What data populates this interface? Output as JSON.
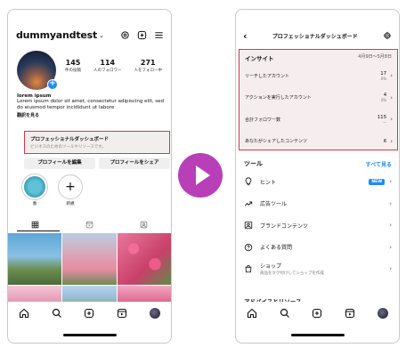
{
  "left": {
    "username": "dummyandtest",
    "stats": [
      {
        "num": "145",
        "label": "件の投稿"
      },
      {
        "num": "114",
        "label": "人のフォロワー"
      },
      {
        "num": "271",
        "label": "人をフォロー中"
      }
    ],
    "bio": {
      "name": "lorem ipsum",
      "text": "Lorem ipsum dolor sit amet, consectetur adipiscing elit, sed do eiusmod tempor incididunt ut labore",
      "translate": "翻訳を見る"
    },
    "dashboard": {
      "title": "プロフェッショナルダッシュボード",
      "subtitle": "ビジネスのためのツールやリソースです。"
    },
    "buttons": {
      "edit": "プロフィールを編集",
      "share": "プロフィールをシェア"
    },
    "highlights": [
      {
        "label": "春"
      },
      {
        "label": "新規"
      }
    ]
  },
  "right": {
    "title": "プロフェッショナルダッシュボード",
    "insights": {
      "title": "インサイト",
      "dates": "4月9日〜5月8日",
      "rows": [
        {
          "label": "リーチしたアカウント",
          "value": "17",
          "pct": "0%"
        },
        {
          "label": "アクションを実行したアカウント",
          "value": "4",
          "pct": "0%"
        },
        {
          "label": "合計フォロワー数",
          "value": "115",
          "pct": "—"
        },
        {
          "label": "あなたがシェアしたコンテンツ",
          "value": "6",
          "pct": ""
        }
      ]
    },
    "tools": {
      "title": "ツール",
      "see_all": "すべて見る",
      "items": [
        {
          "label": "ヒント",
          "sub": "",
          "badge": "NEW",
          "icon": "lightbulb-icon"
        },
        {
          "label": "広告ツール",
          "sub": "",
          "badge": "",
          "icon": "trend-arrow-icon"
        },
        {
          "label": "ブランドコンテンツ",
          "sub": "",
          "badge": "",
          "icon": "branded-content-icon"
        },
        {
          "label": "よくある質問",
          "sub": "",
          "badge": "",
          "icon": "question-icon"
        },
        {
          "label": "ショップ",
          "sub": "商品をタグ付けしてショップを作成",
          "badge": "",
          "icon": "shopping-bag-icon"
        }
      ]
    },
    "advice": "アドバイスとリソース"
  },
  "colors": {
    "highlight_border": "#d9364f",
    "play_button": "#b83fb8",
    "link_blue": "#1a8cff"
  }
}
